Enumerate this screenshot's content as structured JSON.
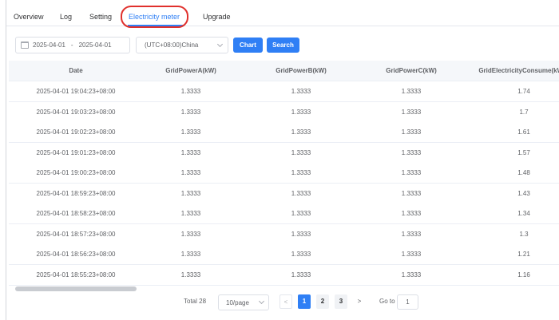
{
  "tabs": [
    {
      "label": "Overview",
      "active": false
    },
    {
      "label": "Log",
      "active": false
    },
    {
      "label": "Setting",
      "active": false
    },
    {
      "label": "Electricity meter",
      "active": true
    },
    {
      "label": "Upgrade",
      "active": false
    }
  ],
  "toolbar": {
    "date_start": "2025-04-01",
    "date_separator": "-",
    "date_end": "2025-04-01",
    "timezone": "(UTC+08:00)China",
    "chart_label": "Chart",
    "search_label": "Search"
  },
  "table": {
    "columns": [
      "Date",
      "GridPowerA(kW)",
      "GridPowerB(kW)",
      "GridPowerC(kW)",
      "GridElectricityConsume(kWh)"
    ],
    "rows": [
      [
        "2025-04-01 19:04:23+08:00",
        "1.3333",
        "1.3333",
        "1.3333",
        "1.74"
      ],
      [
        "2025-04-01 19:03:23+08:00",
        "1.3333",
        "1.3333",
        "1.3333",
        "1.7"
      ],
      [
        "2025-04-01 19:02:23+08:00",
        "1.3333",
        "1.3333",
        "1.3333",
        "1.61"
      ],
      [
        "2025-04-01 19:01:23+08:00",
        "1.3333",
        "1.3333",
        "1.3333",
        "1.57"
      ],
      [
        "2025-04-01 19:00:23+08:00",
        "1.3333",
        "1.3333",
        "1.3333",
        "1.48"
      ],
      [
        "2025-04-01 18:59:23+08:00",
        "1.3333",
        "1.3333",
        "1.3333",
        "1.43"
      ],
      [
        "2025-04-01 18:58:23+08:00",
        "1.3333",
        "1.3333",
        "1.3333",
        "1.34"
      ],
      [
        "2025-04-01 18:57:23+08:00",
        "1.3333",
        "1.3333",
        "1.3333",
        "1.3"
      ],
      [
        "2025-04-01 18:56:23+08:00",
        "1.3333",
        "1.3333",
        "1.3333",
        "1.21"
      ],
      [
        "2025-04-01 18:55:23+08:00",
        "1.3333",
        "1.3333",
        "1.3333",
        "1.16"
      ]
    ]
  },
  "pagination": {
    "total_label": "Total 28",
    "page_size": "10/page",
    "prev": "<",
    "pages": [
      "1",
      "2",
      "3"
    ],
    "current_page": "1",
    "next": ">",
    "goto_label": "Go to",
    "goto_value": "1"
  },
  "colors": {
    "accent": "#2f7ff5",
    "highlight_ring": "#e0302c"
  },
  "icons": {
    "date": "calendar-icon",
    "dropdown": "chevron-down-icon"
  }
}
